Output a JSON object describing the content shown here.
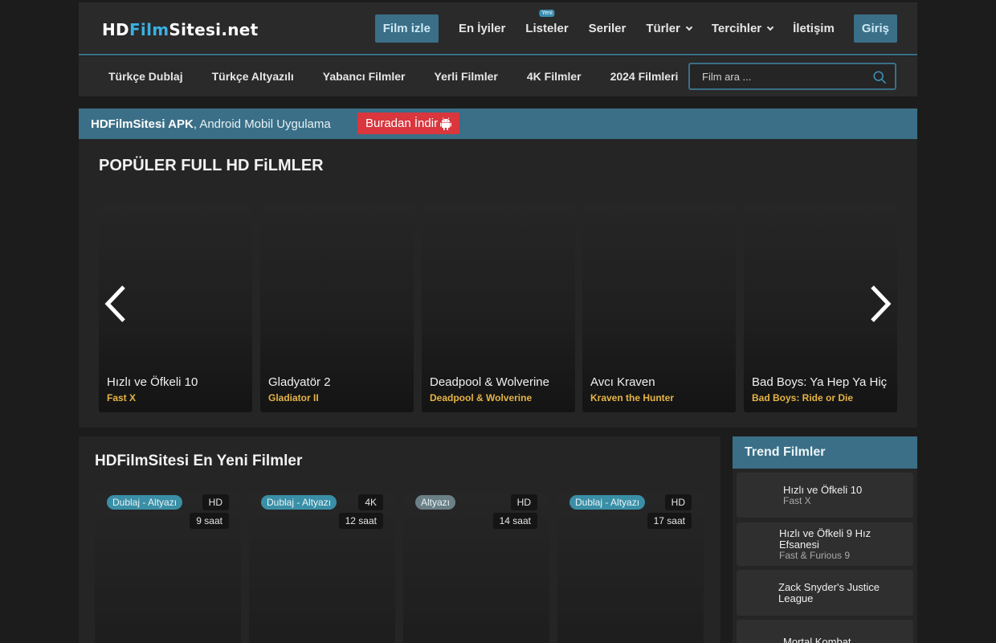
{
  "header": {
    "logo": {
      "part1": "HD",
      "part2": "Film",
      "part3": "Sitesi.net"
    },
    "nav": [
      {
        "label": "Film izle",
        "active": true
      },
      {
        "label": "En İyiler"
      },
      {
        "label": "Listeler",
        "badge": "Yeni"
      },
      {
        "label": "Seriler"
      },
      {
        "label": "Türler",
        "dropdown": true
      },
      {
        "label": "Tercihler",
        "dropdown": true
      },
      {
        "label": "İletişim"
      },
      {
        "label": "Giriş"
      }
    ]
  },
  "subnav": {
    "items": [
      "Türkçe Dublaj",
      "Türkçe Altyazılı",
      "Yabancı Filmler",
      "Yerli Filmler",
      "4K Filmler",
      "2024 Filmleri"
    ],
    "search_placeholder": "Film ara ..."
  },
  "apk": {
    "bold": "HDFilmSitesi APK",
    "text": ", Android Mobil Uygulama",
    "button": "Buradan İndir"
  },
  "popular": {
    "title": "POPÜLER FULL HD FiLMLER",
    "items": [
      {
        "title": "Hızlı ve Öfkeli 10",
        "original": "Fast X"
      },
      {
        "title": "Gladyatör 2",
        "original": "Gladiator II"
      },
      {
        "title": "Deadpool & Wolverine",
        "original": "Deadpool & Wolverine"
      },
      {
        "title": "Avcı Kraven",
        "original": "Kraven the Hunter"
      },
      {
        "title": "Bad Boys: Ya Hep Ya Hiç",
        "original": "Bad Boys: Ride or Die"
      }
    ]
  },
  "latest": {
    "title": "HDFilmSitesi En Yeni Filmler",
    "items": [
      {
        "tag": "Dublaj - Altyazı",
        "quality": "HD",
        "time": "9 saat"
      },
      {
        "tag": "Dublaj - Altyazı",
        "quality": "4K",
        "time": "12 saat"
      },
      {
        "tag": "Altyazı",
        "quality": "HD",
        "time": "14 saat"
      },
      {
        "tag": "Dublaj - Altyazı",
        "quality": "HD",
        "time": "17 saat"
      }
    ]
  },
  "trend": {
    "title": "Trend Filmler",
    "items": [
      {
        "title": "Hızlı ve Öfkeli 10",
        "original": "Fast X"
      },
      {
        "title": "Hızlı ve Öfkeli 9 Hız Efsanesi",
        "original": "Fast & Furious 9"
      },
      {
        "title": "Zack Snyder's Justice League",
        "original": ""
      },
      {
        "title": "Mortal Kombat",
        "original": ""
      }
    ]
  },
  "colors": {
    "accent": "#3a6f87",
    "logo_blue": "#3ab0e2",
    "original_title": "#e5b445",
    "apk_button": "#d9363e"
  }
}
